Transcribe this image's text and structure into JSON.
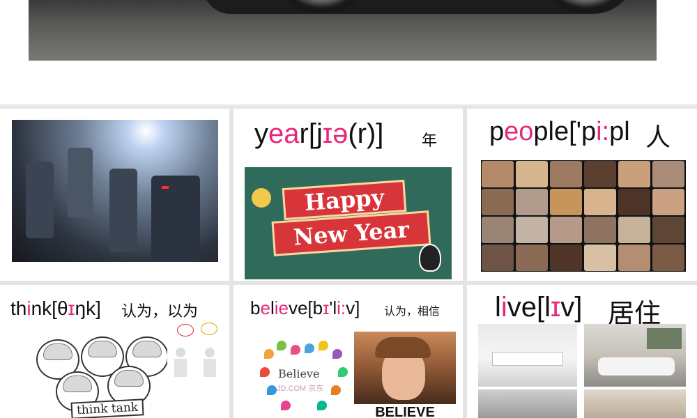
{
  "cards": [
    {
      "id": "robots",
      "image": "robot-army-photo"
    },
    {
      "id": "year",
      "word_parts": [
        {
          "t": "y",
          "pink": false
        },
        {
          "t": "ea",
          "pink": true
        },
        {
          "t": "r",
          "pink": false
        },
        {
          "t": "[j",
          "pink": false
        },
        {
          "t": "ɪ",
          "pink": true
        },
        {
          "t": "ə",
          "pink": true
        },
        {
          "t": "(r)]",
          "pink": false
        }
      ],
      "meaning": "年",
      "image_text": [
        "Happy",
        "New Year"
      ]
    },
    {
      "id": "people",
      "word_parts": [
        {
          "t": "p",
          "pink": false
        },
        {
          "t": "eo",
          "pink": true
        },
        {
          "t": "ple['p",
          "pink": false
        },
        {
          "t": "i:",
          "pink": true
        },
        {
          "t": "pl",
          "pink": false
        }
      ],
      "meaning": "人"
    },
    {
      "id": "think",
      "word_parts": [
        {
          "t": "th",
          "pink": false
        },
        {
          "t": "i",
          "pink": true
        },
        {
          "t": "nk[θ",
          "pink": false
        },
        {
          "t": "ɪ",
          "pink": true
        },
        {
          "t": "ŋk]",
          "pink": false
        }
      ],
      "meaning": "认为，以为",
      "image_text": "think tank"
    },
    {
      "id": "believe",
      "word_parts": [
        {
          "t": "b",
          "pink": false
        },
        {
          "t": "e",
          "pink": true
        },
        {
          "t": "l",
          "pink": false
        },
        {
          "t": "ie",
          "pink": true
        },
        {
          "t": "ve[b",
          "pink": false
        },
        {
          "t": "ɪ",
          "pink": true
        },
        {
          "t": "'l",
          "pink": false
        },
        {
          "t": "i:",
          "pink": true
        },
        {
          "t": "v]",
          "pink": false
        }
      ],
      "meaning": "认为，相信",
      "image_text": [
        "Believe",
        "JD.COM 京东",
        "BELIEVE"
      ]
    },
    {
      "id": "live",
      "word_parts": [
        {
          "t": "l",
          "pink": false
        },
        {
          "t": "i",
          "pink": true
        },
        {
          "t": "ve[l",
          "pink": false
        },
        {
          "t": "ɪ",
          "pink": true
        },
        {
          "t": "v]",
          "pink": false
        }
      ],
      "meaning": "居住"
    }
  ],
  "colors": {
    "highlight": "#e6287a",
    "text": "#111111",
    "background": "#e4e4e4"
  }
}
